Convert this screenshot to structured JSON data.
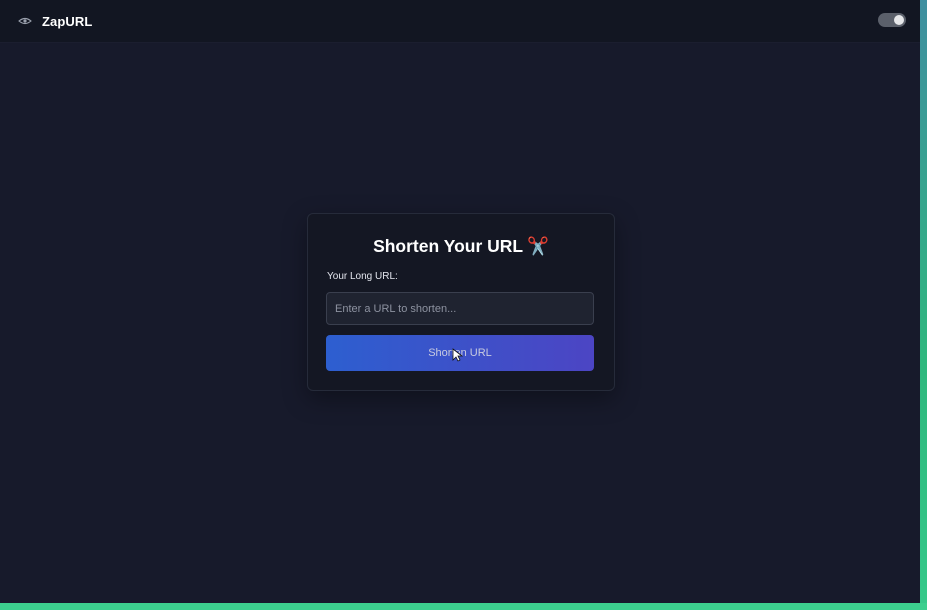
{
  "app": {
    "brand": "ZapURL",
    "logo_icon": "eye-icon",
    "theme_toggle_icon": "toggle-switch"
  },
  "card": {
    "title": "Shorten Your URL",
    "title_emoji": "✂️",
    "field_label": "Your Long URL:",
    "input_value": "",
    "input_placeholder": "Enter a URL to shorten...",
    "button_label": "Shorten URL"
  },
  "colors": {
    "background": "#171a2b",
    "topbar": "#121622",
    "card": "#141723",
    "button_start": "#2d5fd0",
    "button_end": "#4c45c4",
    "frame_accent": "#3ccf8e"
  }
}
